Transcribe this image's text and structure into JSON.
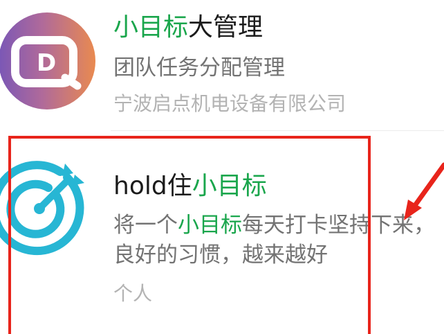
{
  "items": [
    {
      "title_highlight": "小目标",
      "title_rest": "大管理",
      "description": "团队任务分配管理",
      "developer": "宁波启点机电设备有限公司",
      "icon": "q-logo-icon"
    },
    {
      "title_prefix": "hold住",
      "title_highlight": "小目标",
      "desc_line1_prefix": "将一个",
      "desc_line1_highlight": "小目标",
      "desc_line1_rest": "每天打卡坚持下来，",
      "desc_line2": "良好的习惯，越来越好",
      "developer": "个人",
      "icon": "target-arrow-icon"
    }
  ],
  "colors": {
    "highlight": "#1aa64c",
    "annotation_red": "#e8241b",
    "target_blue": "#27b6d4"
  }
}
